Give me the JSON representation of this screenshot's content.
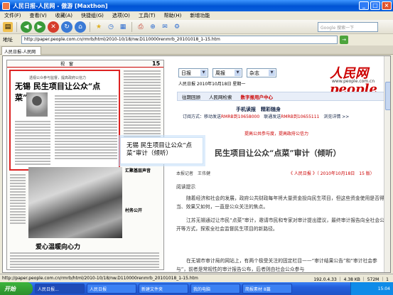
{
  "window": {
    "title": "人民日报-人民网 - 傲游 [Maxthon]",
    "minimize": "_",
    "maximize": "□",
    "close": "×"
  },
  "menu": [
    "文件(F)",
    "查看(V)",
    "收藏(A)",
    "快捷组(G)",
    "选项(O)",
    "工具(T)",
    "帮助(H)",
    "新增功能"
  ],
  "toolbar": {
    "search_placeholder": "Google 搜索一下"
  },
  "address": {
    "label": "地址",
    "value": "http://paper.people.com.cn/rmrb/html/2010-10/18/nw.D110000renmrb_20101018_1-15.htm"
  },
  "tab": {
    "label": "人民日报-人民网"
  },
  "paper": {
    "header": "视　窗",
    "page_no": "15",
    "sub_headline": "透视公众参与监督，提高政府公信力",
    "headline": "无锡 民生项目让公众“点菜”审计",
    "side_head1": "汇聚基层声音",
    "side_head2": "村务公开",
    "bottom_head": "爱心温暖向心力"
  },
  "tooltip": {
    "text": "无锡 民生项目让公众“点菜”审计（倾听）"
  },
  "right": {
    "sel1": "日报",
    "sel2": "周报",
    "sel3": "杂志",
    "logo": "人民网people",
    "logo_sub": "www.people.com.cn",
    "date": "人民日报 2010年10月18日 星期一",
    "nav": [
      "往期回顾",
      "人民网检索",
      "数字报用户中心"
    ],
    "mobile_title": "手机读报　精彩随身",
    "mobile_line_a": "订阅方式：移动发送",
    "mobile_code_a": "RMRB到10658000",
    "mobile_line_b": "　联通发送",
    "mobile_code_b": "RMRB到10655111",
    "mobile_detail": "　浏览详情 >>",
    "note": "提高公共参与度，提高政府公信力",
    "article_title": "民生项目让公众“点菜”审计（倾听）",
    "author": "本报记者　王伟健",
    "source": "《 人民日报 》（ 2010年10月18日　15 版）",
    "para1": "阅读提示",
    "para2": "随着经济和社会的发展，政府公共财政每年将大量资金投向民生项目，但这些资金使用是否得当、效果又如何，一直是公众关注的焦点。",
    "para3": "江苏无锡通过让市民“点菜”审计，邀请市民和专家对审计提出建议，最终审计报告向全社会公开等方式，探索全社会监督民生项目的新路径。",
    "para4": "在无锡市审计局的网站上，有两个极受关注的固定栏目——“审计结果公告”和“审计社会参与”，前者是常规性的审计报告公布，后者则由社会公众参与"
  },
  "status": {
    "url": "http://paper.people.com.cn/rmrb/html/2010-10/18/nw.D110000renmrb_20101018_1-15.htm",
    "info": "192.0.4.33 ｜ 4.38 KB ｜ 572M ｜ 1"
  },
  "taskbar": {
    "start": "开始",
    "tasks": [
      "人民日报...",
      "人民日报",
      "新建文件夹",
      "我的电脑",
      "简报素材 8篇"
    ],
    "clock": "15:04"
  }
}
